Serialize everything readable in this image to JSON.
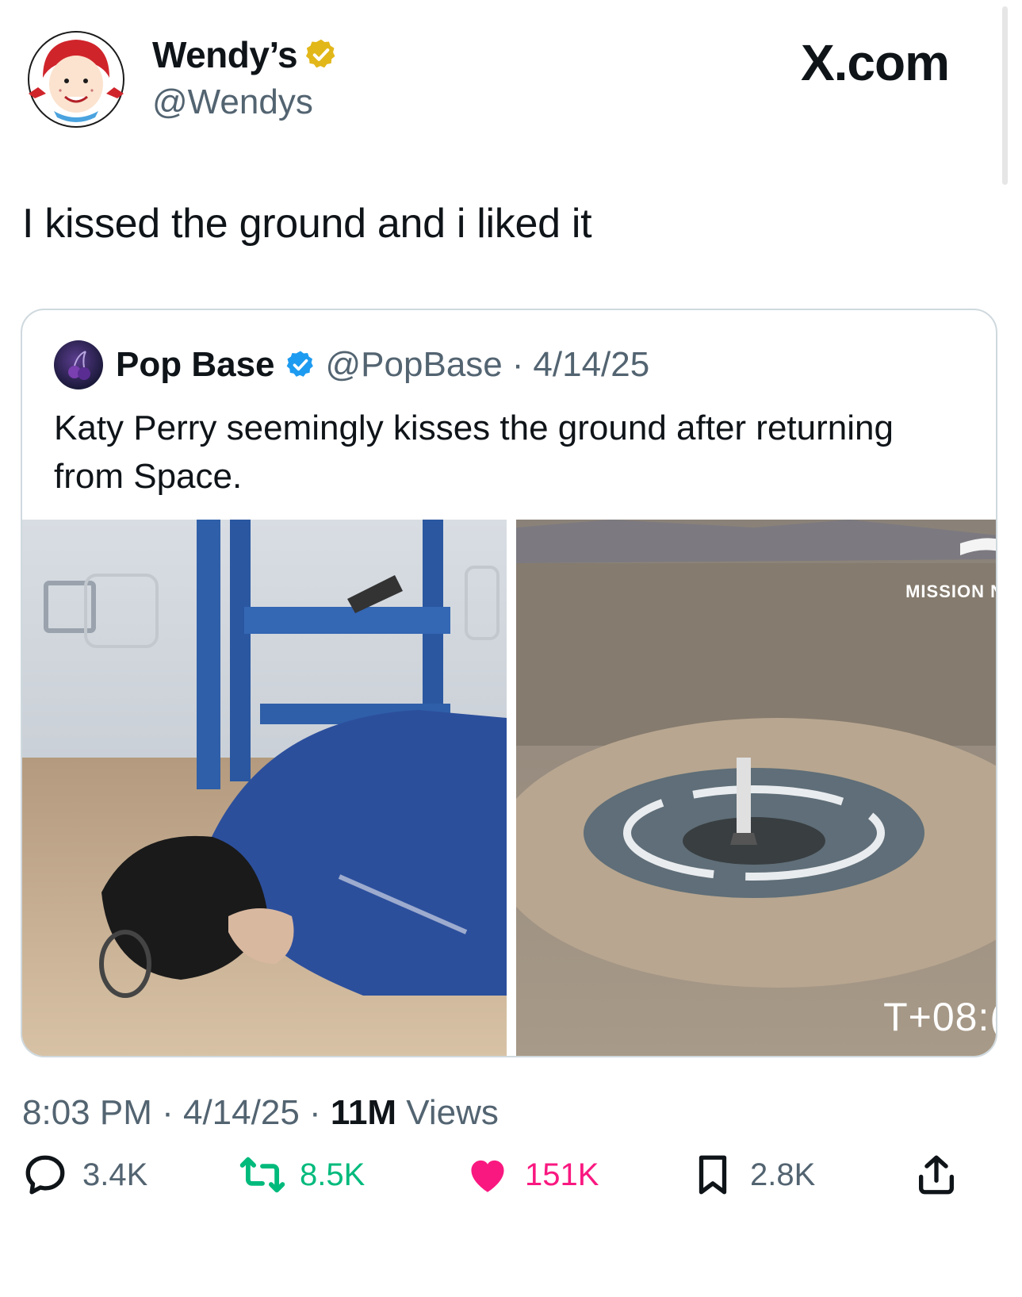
{
  "author": {
    "name": "Wendy’s",
    "handle": "@Wendys"
  },
  "brand": "X.com",
  "tweet_text": "I kissed the ground and i liked it",
  "quoted": {
    "name": "Pop Base",
    "handle": "@PopBase",
    "sep": "·",
    "date": "4/14/25",
    "text": "Katy Perry seemingly kisses the ground after returning from Space.",
    "right_image_overlay": {
      "top": "MISSION N",
      "bottom": "T+08:("
    }
  },
  "meta": {
    "time": "8:03 PM",
    "sep": " · ",
    "date": "4/14/25",
    "views_count": "11M",
    "views_label": " Views"
  },
  "actions": {
    "replies": "3.4K",
    "reposts": "8.5K",
    "likes": "151K",
    "bookmarks": "2.8K"
  },
  "colors": {
    "verified_gold": "#e2b719",
    "verified_blue": "#1d9bf0",
    "repost_green": "#00ba7c",
    "like_pink": "#f91880"
  }
}
